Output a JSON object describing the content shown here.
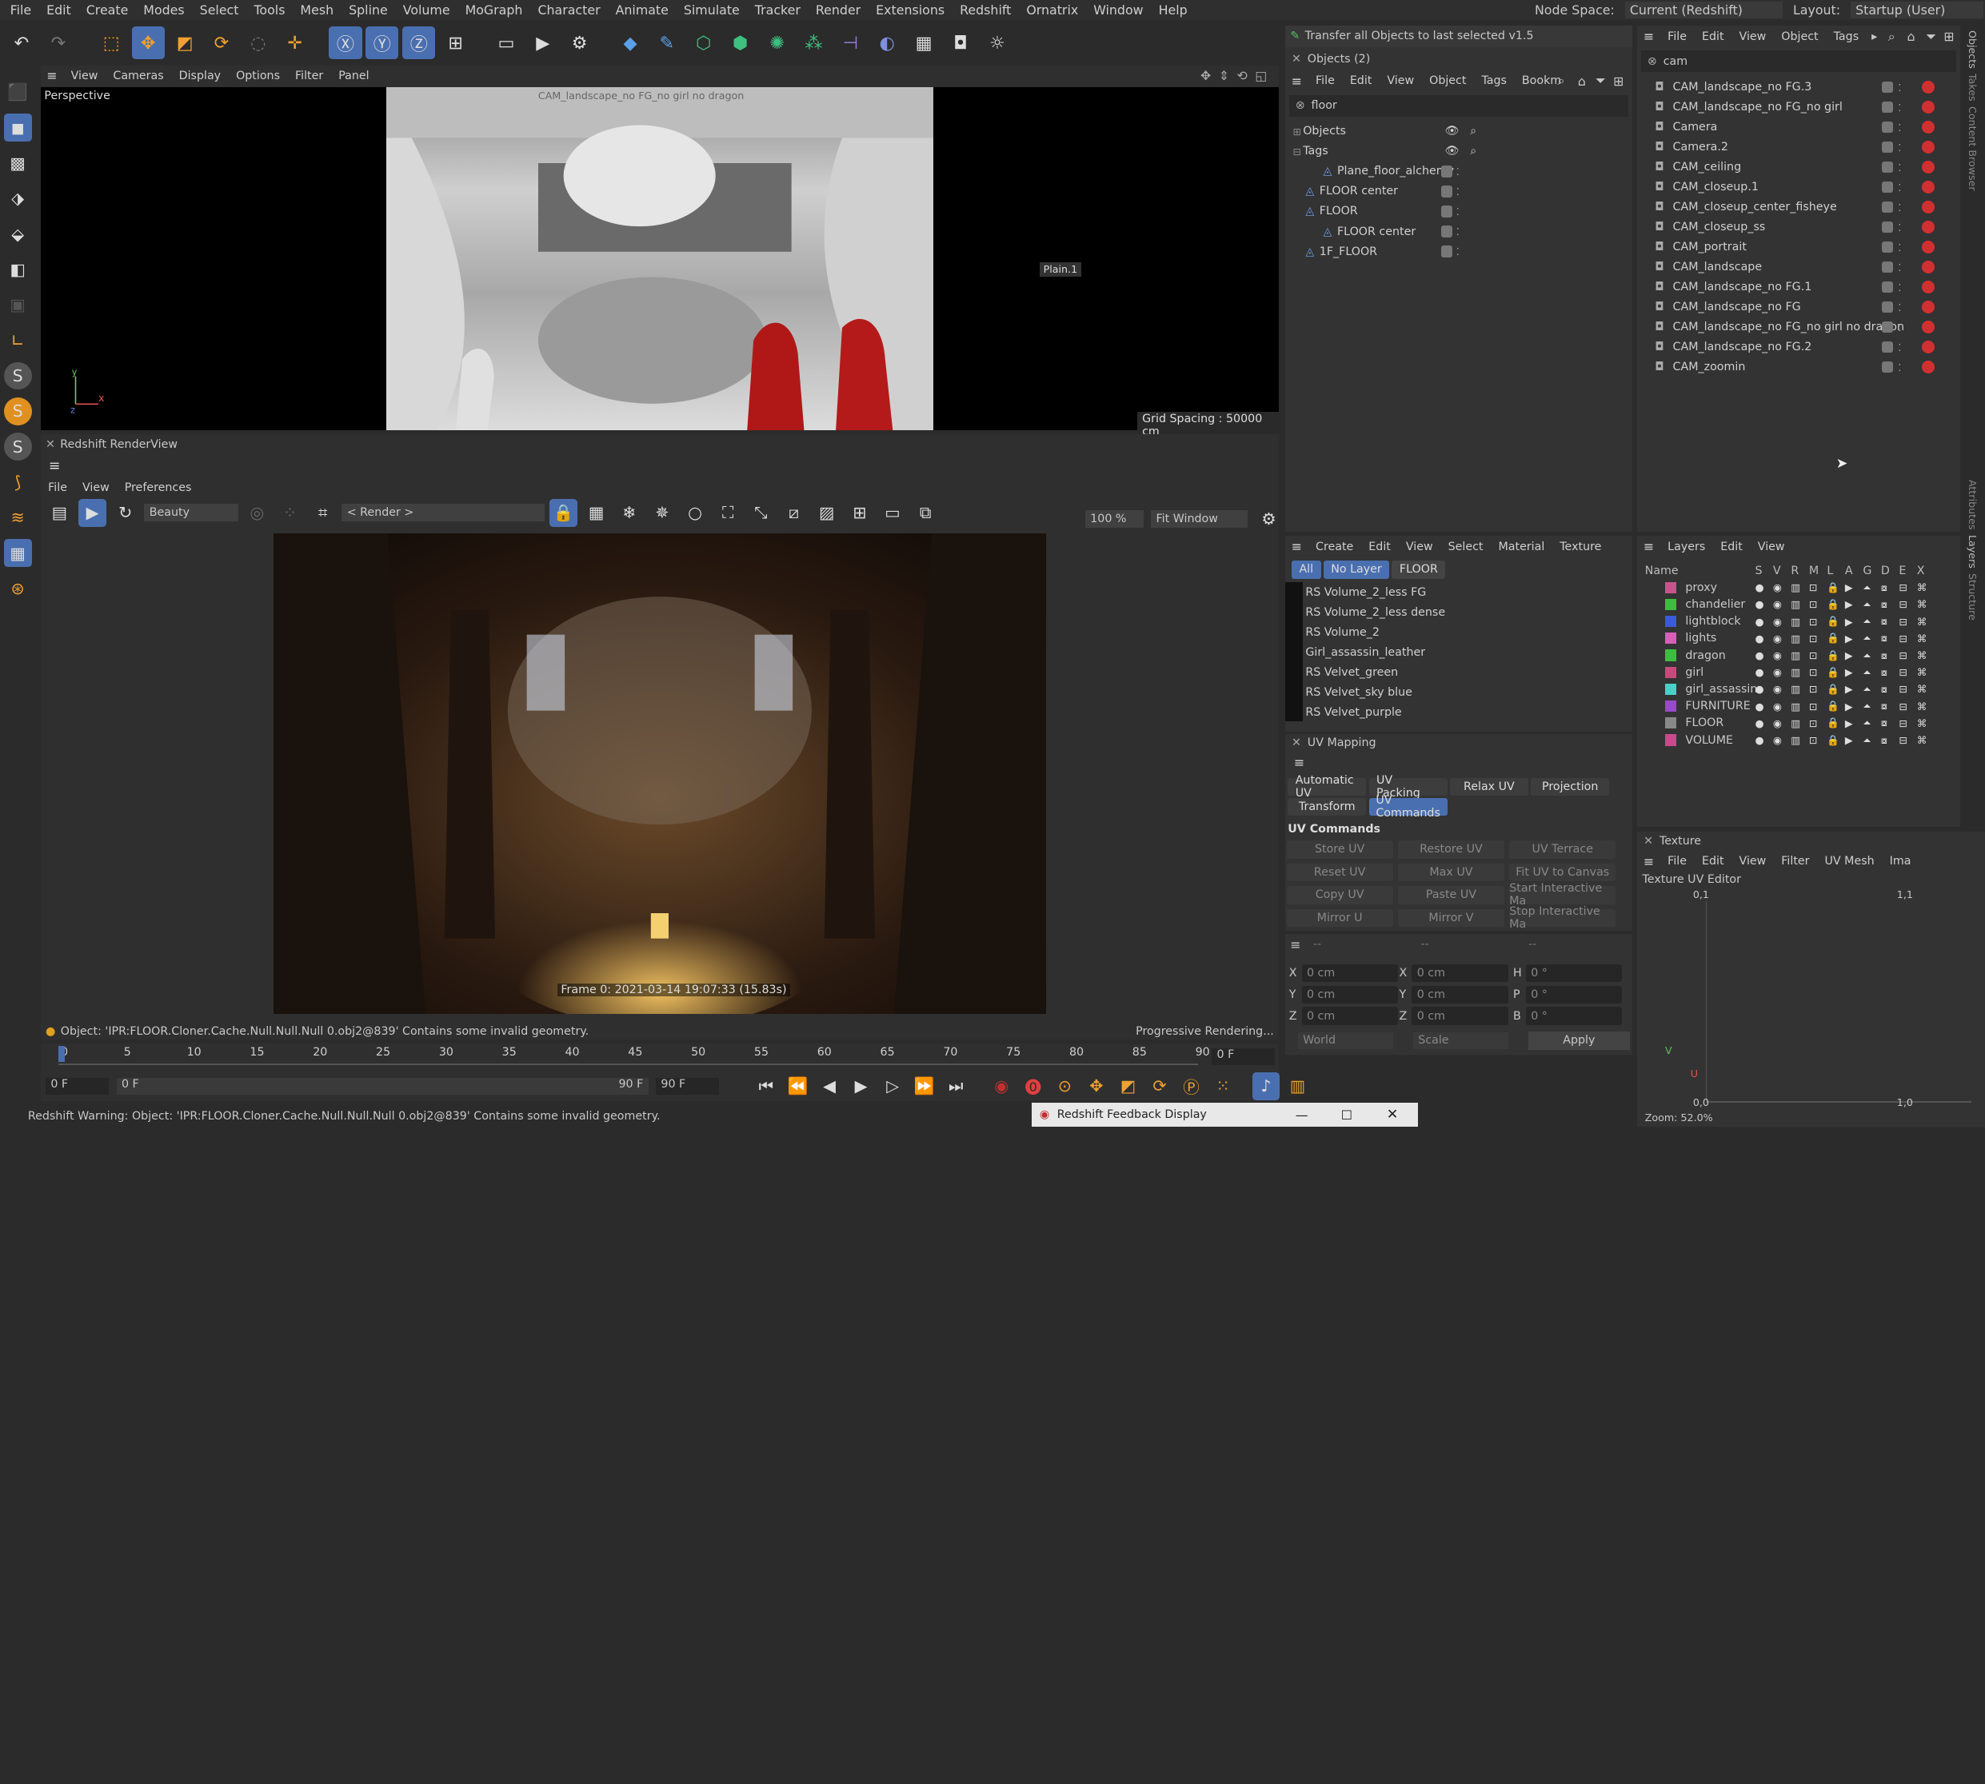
{
  "menubar": {
    "items": [
      "File",
      "Edit",
      "Create",
      "Modes",
      "Select",
      "Tools",
      "Mesh",
      "Spline",
      "Volume",
      "MoGraph",
      "Character",
      "Animate",
      "Simulate",
      "Tracker",
      "Render",
      "Extensions",
      "Redshift",
      "Ornatrix",
      "Window",
      "Help"
    ],
    "node_space_label": "Node Space:",
    "node_space_value": "Current (Redshift)",
    "layout_label": "Layout:",
    "layout_value": "Startup (User)"
  },
  "viewport": {
    "menu": [
      "View",
      "Cameras",
      "Display",
      "Options",
      "Filter",
      "Panel"
    ],
    "name": "Perspective",
    "camera_label": "CAM_landscape_no FG_no girl no dragon",
    "object_label": "Plain.1",
    "grid_spacing": "Grid Spacing : 50000 cm"
  },
  "renderview": {
    "title": "Redshift RenderView",
    "menu": [
      "File",
      "View",
      "Preferences"
    ],
    "aov": "Beauty",
    "render_select": "< Render >",
    "zoom": "100 %",
    "fit": "Fit Window",
    "frame_info": "Frame 0: 2021-03-14 19:07:33 (15.83s)",
    "status": "Object: 'IPR:FLOOR.Cloner.Cache.Null.Null.Null 0.obj2@839' Contains some invalid geometry.",
    "progress": "Progressive Rendering..."
  },
  "objects_panel": {
    "script_button": "Transfer all Objects to last selected v1.5",
    "title": "Objects (2)",
    "menu": [
      "File",
      "Edit",
      "View",
      "Object",
      "Tags",
      "Bookm"
    ],
    "search": "floor",
    "groups": [
      "Objects",
      "Tags"
    ],
    "rows": [
      {
        "name": "Plane_floor_alchemy",
        "indent": 1
      },
      {
        "name": "FLOOR center",
        "indent": 0
      },
      {
        "name": "FLOOR",
        "indent": 0
      },
      {
        "name": "FLOOR center",
        "indent": 1
      },
      {
        "name": "1F_FLOOR",
        "indent": 0
      }
    ]
  },
  "camera_panel": {
    "menu": [
      "File",
      "Edit",
      "View",
      "Object",
      "Tags"
    ],
    "search": "cam",
    "rows": [
      "CAM_landscape_no FG.3",
      "CAM_landscape_no FG_no girl",
      "Camera",
      "Camera.2",
      "CAM_ceiling",
      "CAM_closeup.1",
      "CAM_closeup_center_fisheye",
      "CAM_closeup_ss",
      "CAM_portrait",
      "CAM_landscape",
      "CAM_landscape_no FG.1",
      "CAM_landscape_no FG",
      "CAM_landscape_no FG_no girl no dragon",
      "CAM_landscape_no FG.2",
      "CAM_zoomin"
    ]
  },
  "side_tabs": {
    "right": [
      "Objects",
      "Takes",
      "Content Browser"
    ],
    "right2": [
      "Attributes",
      "Layers",
      "Structure"
    ]
  },
  "materials": {
    "menu": [
      "Create",
      "Edit",
      "View",
      "Select",
      "Material",
      "Texture"
    ],
    "filters": [
      "All",
      "No Layer",
      "FLOOR"
    ],
    "rows": [
      "RS Volume_2_less FG",
      "RS Volume_2_less dense",
      "RS Volume_2",
      "Girl_assassin_leather",
      "RS Velvet_green",
      "RS Velvet_sky blue",
      "RS Velvet_purple"
    ]
  },
  "layers": {
    "menu": [
      "Layers",
      "Edit",
      "View"
    ],
    "header": [
      "Name",
      "S",
      "V",
      "R",
      "M",
      "L",
      "A",
      "G",
      "D",
      "E",
      "X"
    ],
    "rows": [
      {
        "name": "proxy",
        "color": "#c8548c"
      },
      {
        "name": "chandelier",
        "color": "#3ebd3e"
      },
      {
        "name": "lightblock",
        "color": "#3b5bd8"
      },
      {
        "name": "lights",
        "color": "#d660b8"
      },
      {
        "name": "dragon",
        "color": "#3ebd3e"
      },
      {
        "name": "girl",
        "color": "#c84a7c"
      },
      {
        "name": "girl_assassin",
        "color": "#4ad0c8"
      },
      {
        "name": "FURNITURE",
        "color": "#9a4ac8"
      },
      {
        "name": "FLOOR",
        "color": "#888888"
      },
      {
        "name": "VOLUME",
        "color": "#c84a8c"
      }
    ]
  },
  "uv_mapping": {
    "title": "UV Mapping",
    "tabs_row1": [
      "Automatic UV",
      "UV Packing",
      "Relax UV",
      "Projection"
    ],
    "tabs_row2": [
      "Transform",
      "UV Commands"
    ],
    "section": "UV Commands",
    "buttons": [
      "Store UV",
      "Restore UV",
      "UV Terrace",
      "Reset UV",
      "Max UV",
      "Fit UV to Canvas",
      "Copy UV",
      "Paste UV",
      "Start Interactive Ma",
      "Mirror U",
      "Mirror V",
      "Stop Interactive Ma"
    ]
  },
  "coordinates": {
    "head": [
      "--",
      "--",
      "--"
    ],
    "rows": [
      {
        "l1": "X",
        "v1": "0 cm",
        "l2": "X",
        "v2": "0 cm",
        "l3": "H",
        "v3": "0 °"
      },
      {
        "l1": "Y",
        "v1": "0 cm",
        "l2": "Y",
        "v2": "0 cm",
        "l3": "P",
        "v3": "0 °"
      },
      {
        "l1": "Z",
        "v1": "0 cm",
        "l2": "Z",
        "v2": "0 cm",
        "l3": "B",
        "v3": "0 °"
      }
    ],
    "mode": "World",
    "scale": "Scale",
    "apply": "Apply"
  },
  "texture": {
    "title": "Texture",
    "menu": [
      "File",
      "Edit",
      "View",
      "Filter",
      "UV Mesh",
      "Ima"
    ],
    "editor_label": "Texture UV Editor",
    "top_left": "0,1",
    "top_right": "1,1",
    "bottom_left": "0,0",
    "bottom_right": "1,0",
    "zoom": "Zoom: 52.0%",
    "v_label": "V",
    "u_label": "U"
  },
  "timeline": {
    "ticks": [
      "0",
      "5",
      "10",
      "15",
      "20",
      "25",
      "30",
      "35",
      "40",
      "45",
      "50",
      "55",
      "60",
      "65",
      "70",
      "75",
      "80",
      "85",
      "90"
    ],
    "current": "0 F",
    "start": "0 F",
    "range_start": "0 F",
    "range_end": "90 F",
    "end": "90 F"
  },
  "statusbar": {
    "message": "Redshift Warning: Object: 'IPR:FLOOR.Cloner.Cache.Null.Null.Null 0.obj2@839' Contains some invalid geometry.",
    "feedback_title": "Redshift Feedback Display"
  }
}
